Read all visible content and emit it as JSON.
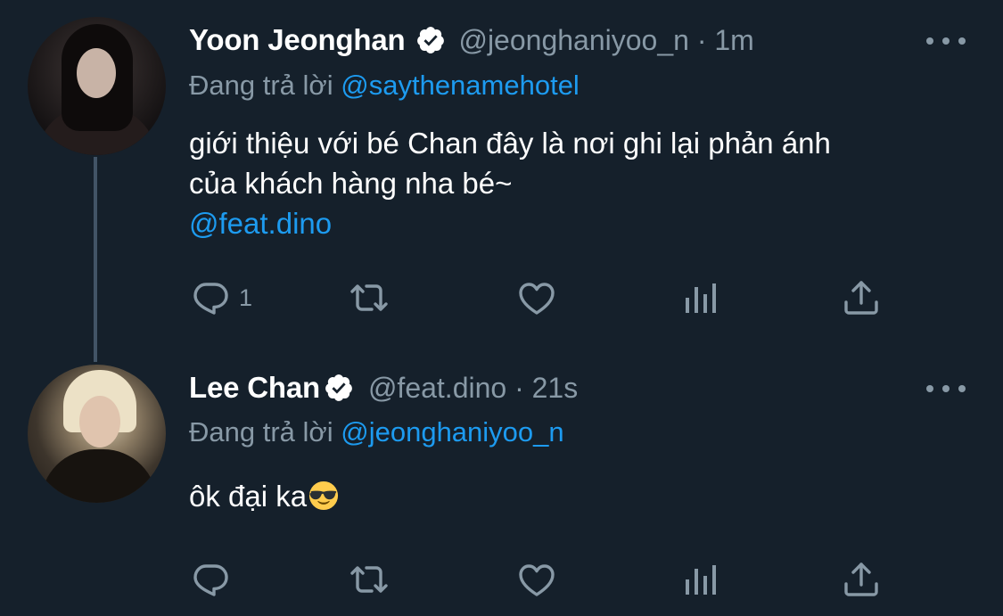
{
  "tweets": [
    {
      "display_name": "Yoon Jeonghan",
      "handle": "@jeonghaniyoo_n",
      "time": "1m",
      "reply_prefix": "Đang trả lời",
      "reply_to": "@saythenamehotel",
      "text_lines": [
        "giới thiệu với bé Chan đây là nơi ghi lại phản ánh",
        "của khách hàng nha bé~"
      ],
      "mention": "@feat.dino",
      "reply_count": "1",
      "verified": true
    },
    {
      "display_name": "Lee Chan",
      "handle": "@feat.dino",
      "time": "21s",
      "reply_prefix": "Đang trả lời",
      "reply_to": "@jeonghaniyoo_n",
      "text": "ôk đại ka",
      "emoji": "smiling-face-with-sunglasses",
      "verified": true
    }
  ],
  "separator": " · ",
  "colors": {
    "background": "#15202b",
    "text": "#ffffff",
    "muted": "#8899a6",
    "accent": "#1d9bf0",
    "thread_line": "#425466"
  }
}
